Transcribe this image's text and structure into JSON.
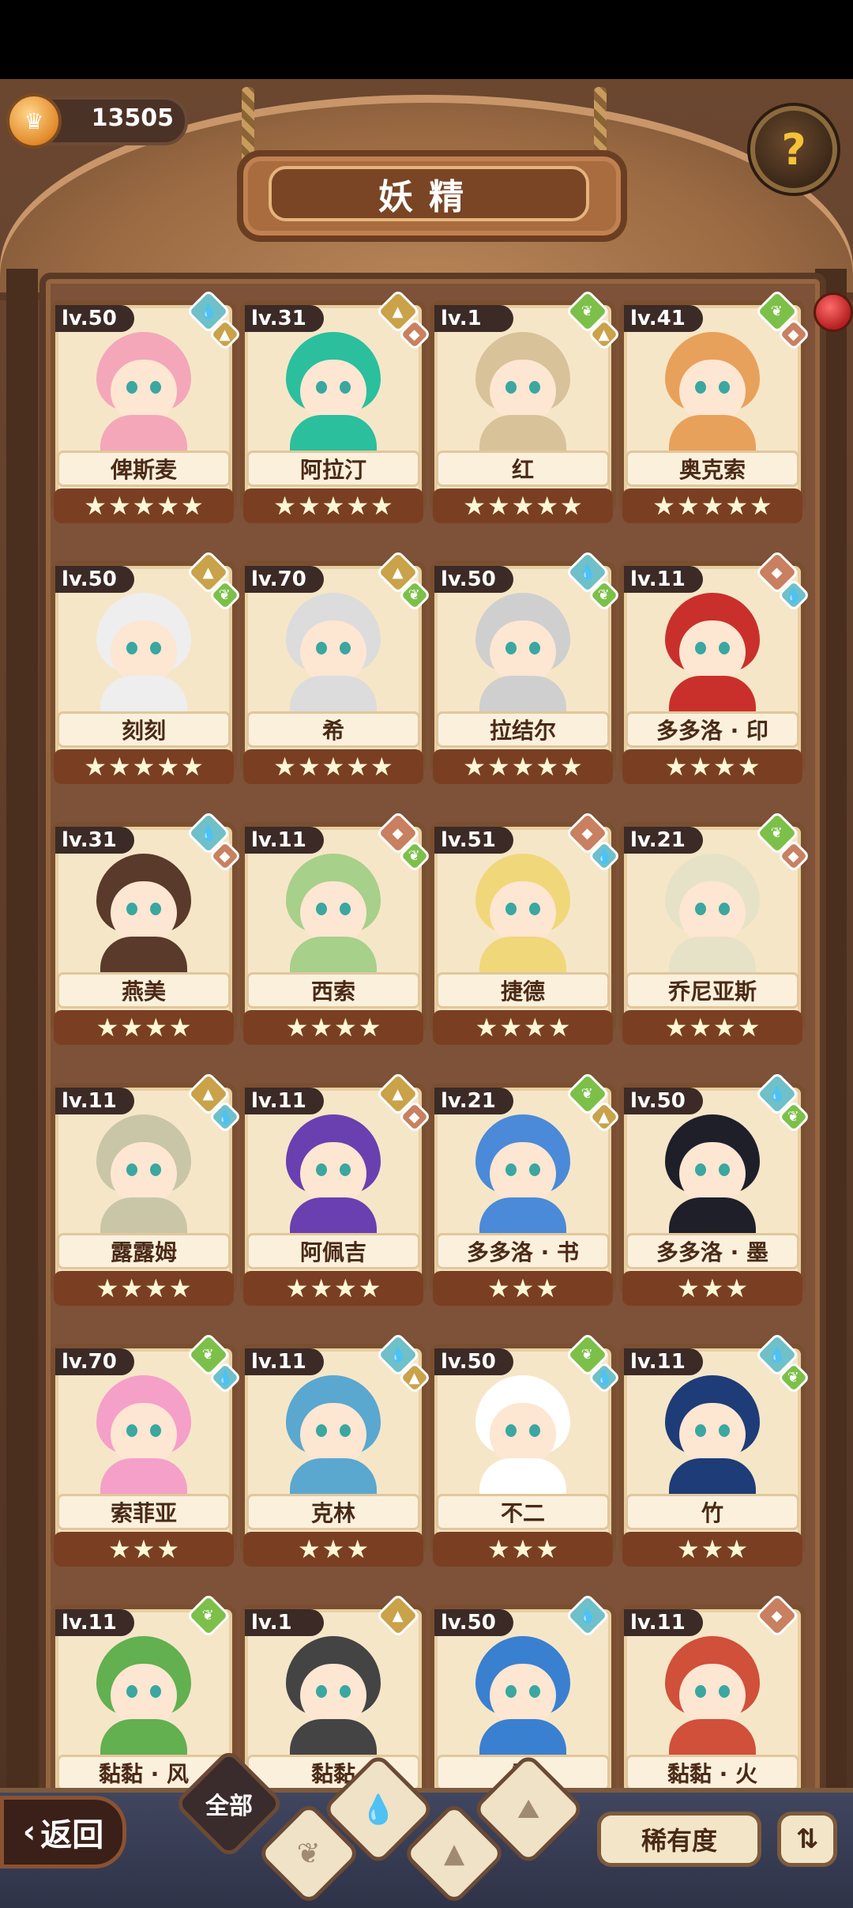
{
  "header": {
    "coins": "13505",
    "title": "妖精",
    "help_icon": "question-plant-icon"
  },
  "colors": {
    "grass": "#7cc04a",
    "water": "#6fc0c8",
    "rock": "#c9a24a",
    "fire": "#c88060"
  },
  "fairies": [
    {
      "level": "lv.50",
      "name": "俾斯麦",
      "stars": 5,
      "elements": [
        "water",
        "rock"
      ]
    },
    {
      "level": "lv.31",
      "name": "阿拉汀",
      "stars": 5,
      "elements": [
        "rock",
        "fire"
      ]
    },
    {
      "level": "lv.1",
      "name": "红",
      "stars": 5,
      "elements": [
        "grass",
        "rock"
      ]
    },
    {
      "level": "lv.41",
      "name": "奥克索",
      "stars": 5,
      "elements": [
        "grass",
        "fire"
      ]
    },
    {
      "level": "lv.50",
      "name": "刻刻",
      "stars": 5,
      "elements": [
        "rock",
        "grass"
      ]
    },
    {
      "level": "lv.70",
      "name": "希",
      "stars": 5,
      "elements": [
        "rock",
        "grass"
      ]
    },
    {
      "level": "lv.50",
      "name": "拉结尔",
      "stars": 5,
      "elements": [
        "water",
        "grass"
      ]
    },
    {
      "level": "lv.11",
      "name": "多多洛 · 印",
      "stars": 4,
      "elements": [
        "fire",
        "water"
      ]
    },
    {
      "level": "lv.31",
      "name": "燕美",
      "stars": 4,
      "elements": [
        "water",
        "fire"
      ]
    },
    {
      "level": "lv.11",
      "name": "西索",
      "stars": 4,
      "elements": [
        "fire",
        "grass"
      ]
    },
    {
      "level": "lv.51",
      "name": "捷德",
      "stars": 4,
      "elements": [
        "fire",
        "water"
      ]
    },
    {
      "level": "lv.21",
      "name": "乔尼亚斯",
      "stars": 4,
      "elements": [
        "grass",
        "fire"
      ]
    },
    {
      "level": "lv.11",
      "name": "露露姆",
      "stars": 4,
      "elements": [
        "rock",
        "water"
      ]
    },
    {
      "level": "lv.11",
      "name": "阿佩吉",
      "stars": 4,
      "elements": [
        "rock",
        "fire"
      ]
    },
    {
      "level": "lv.21",
      "name": "多多洛 · 书",
      "stars": 3,
      "elements": [
        "grass",
        "rock"
      ]
    },
    {
      "level": "lv.50",
      "name": "多多洛 · 墨",
      "stars": 3,
      "elements": [
        "water",
        "grass"
      ]
    },
    {
      "level": "lv.70",
      "name": "索菲亚",
      "stars": 3,
      "elements": [
        "grass",
        "water"
      ]
    },
    {
      "level": "lv.11",
      "name": "克林",
      "stars": 3,
      "elements": [
        "water",
        "rock"
      ]
    },
    {
      "level": "lv.50",
      "name": "不二",
      "stars": 3,
      "elements": [
        "grass",
        "water"
      ]
    },
    {
      "level": "lv.11",
      "name": "竹",
      "stars": 3,
      "elements": [
        "water",
        "grass"
      ]
    },
    {
      "level": "lv.11",
      "name": "黏黏 · 风",
      "stars": 0,
      "elements": [
        "grass"
      ]
    },
    {
      "level": "lv.1",
      "name": "黏黏",
      "stars": 0,
      "elements": [
        "rock"
      ]
    },
    {
      "level": "lv.50",
      "name": "黏",
      "stars": 0,
      "elements": [
        "water"
      ]
    },
    {
      "level": "lv.11",
      "name": "黏黏 · 火",
      "stars": 0,
      "elements": [
        "fire"
      ]
    }
  ],
  "bottom": {
    "back_label": "返回",
    "filter_all": "全部",
    "rarity_label": "稀有度"
  }
}
